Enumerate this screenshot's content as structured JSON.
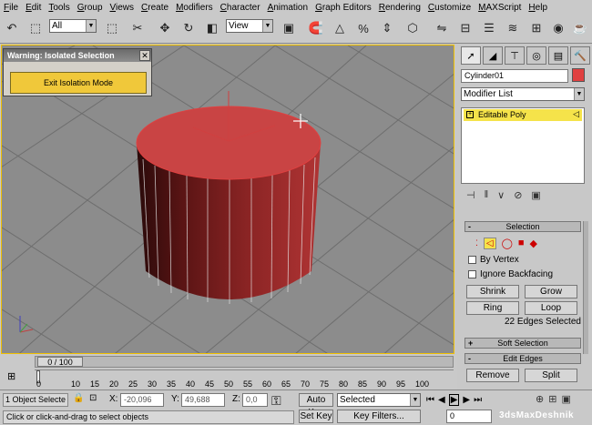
{
  "menu": [
    "File",
    "Edit",
    "Tools",
    "Group",
    "Views",
    "Create",
    "Modifiers",
    "Character",
    "Animation",
    "Graph Editors",
    "Rendering",
    "Customize",
    "MAXScript",
    "Help"
  ],
  "toolbar": {
    "selection_filter": "All",
    "ref_coord": "View"
  },
  "warning": {
    "title": "Warning: Isolated Selection",
    "close": "✕",
    "exit_button": "Exit Isolation Mode"
  },
  "command_panel": {
    "object_name": "Cylinder01",
    "object_color": "#e04040",
    "modifier_list": "Modifier List",
    "stack_item": "Editable Poly",
    "selection_header": "Selection",
    "by_vertex": "By Vertex",
    "ignore_backfacing": "Ignore Backfacing",
    "shrink": "Shrink",
    "grow": "Grow",
    "ring": "Ring",
    "loop": "Loop",
    "selected_status": "22 Edges Selected",
    "soft_selection_header": "Soft Selection",
    "edit_edges_header": "Edit Edges",
    "remove": "Remove",
    "split": "Split",
    "minus": "-",
    "plus": "+"
  },
  "timeline": {
    "frame_counter": "0 / 100",
    "ticks": [
      "0",
      "10",
      "15",
      "20",
      "25",
      "30",
      "35",
      "40",
      "45",
      "50",
      "55",
      "60",
      "65",
      "70",
      "75",
      "80",
      "85",
      "90",
      "95",
      "100"
    ]
  },
  "status": {
    "selection_count": "1 Object Selecte",
    "x_label": "X:",
    "x_value": "-20,096",
    "y_label": "Y:",
    "y_value": "49,688",
    "z_label": "Z:",
    "z_value": "0,0",
    "prompt": "Click or click-and-drag to select objects",
    "auto_key": "Auto Key",
    "set_key": "Set Key",
    "key_mode": "Selected",
    "key_filters": "Key Filters...",
    "current_frame": "0"
  },
  "watermark": "3dsMaxDeshnik",
  "colors": {
    "accent_yellow": "#f0c83a",
    "cylinder_red": "#c03838",
    "viewport_bg": "#8c8c8c"
  }
}
